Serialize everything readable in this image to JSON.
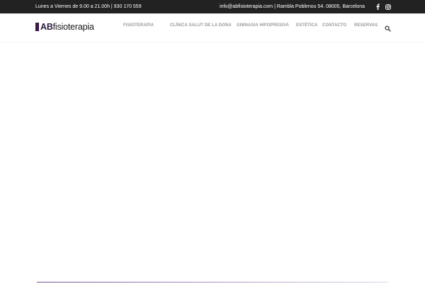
{
  "topbar": {
    "hours": "Lunes a Viernes de 9.00 a 21.00h | 930 170 559",
    "contact": "info@abfisioterapia.com | Rambla Poblenou 54. 08005, Barcelona",
    "social": [
      "facebook-icon",
      "instagram-icon"
    ]
  },
  "logo": {
    "prefix": "AB",
    "suffix": "fisioterapia"
  },
  "nav": {
    "items": [
      {
        "label": "FISIOTERAPIA"
      },
      {
        "label": "CLÍNICA SALUT DE LA DONA"
      },
      {
        "label": "GIMNASIA HIPOPRESIVA"
      },
      {
        "label": "ESTÉTICA"
      },
      {
        "label": "CONTACTO"
      },
      {
        "label": "RESERVAS"
      }
    ],
    "search_icon": "search-icon"
  },
  "colors": {
    "topbar_bg": "#222222",
    "nav_text": "#9a9a9a",
    "brand": "#3b1847",
    "accent_strip": "#b8a6c9"
  }
}
